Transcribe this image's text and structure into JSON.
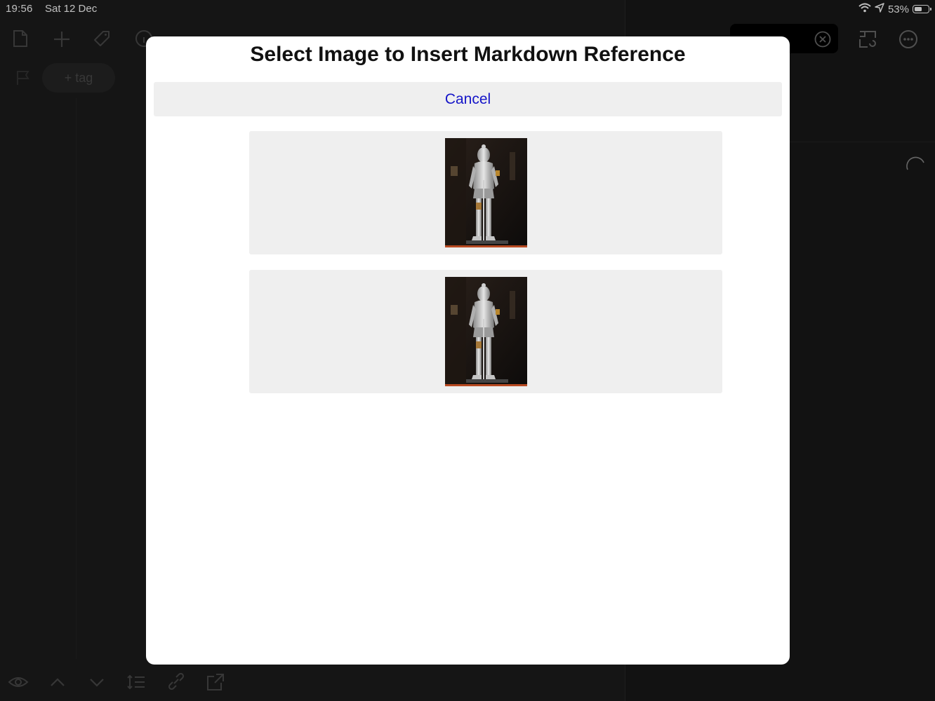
{
  "status_bar": {
    "time": "19:56",
    "date": "Sat 12 Dec",
    "battery": "53%",
    "battery_level": 0.53
  },
  "background": {
    "tag_button": "+ tag"
  },
  "modal": {
    "title": "Select Image to Insert Markdown Reference",
    "cancel_label": "Cancel",
    "images": [
      {
        "icon": "knight-armor-image"
      },
      {
        "icon": "knight-armor-image"
      }
    ]
  },
  "colors": {
    "accent": "#1515c8",
    "modal_bg": "#ffffff",
    "option_bg": "#efefef",
    "app_bg": "#1b1b1b"
  }
}
